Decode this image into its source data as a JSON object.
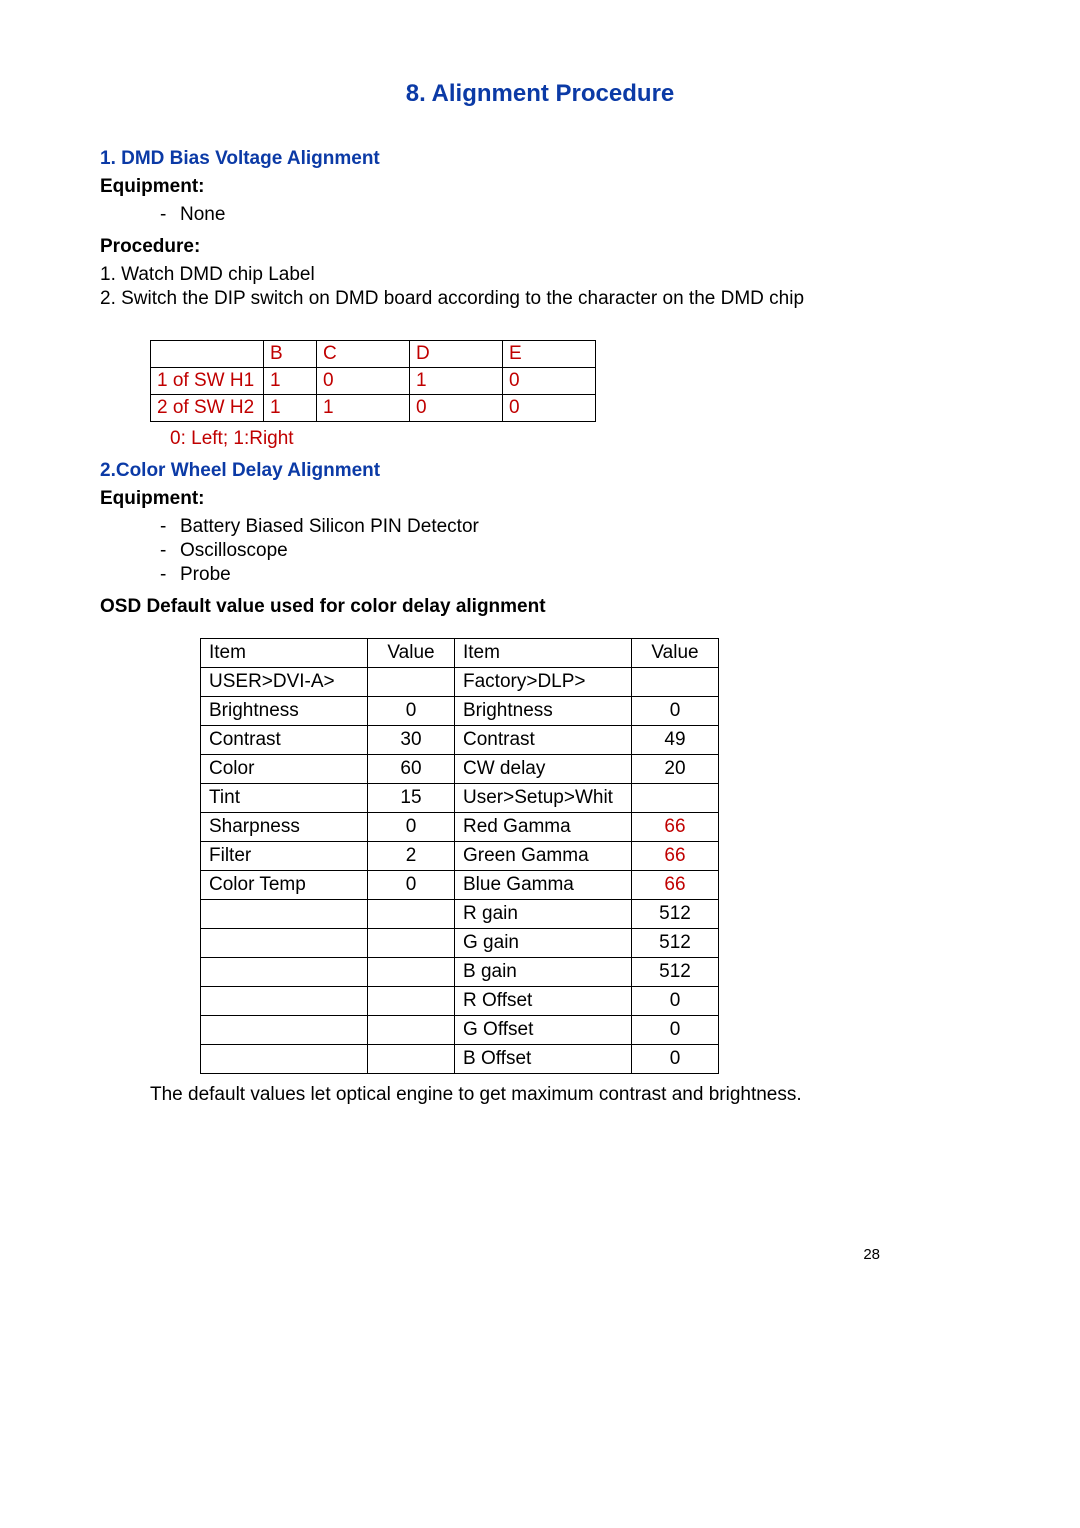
{
  "title": "8. Alignment Procedure",
  "section1": {
    "heading": "1. DMD Bias Voltage Alignment",
    "equipment_label": "Equipment:",
    "equipment_items": [
      "None"
    ],
    "procedure_label": "Procedure:",
    "steps": [
      "1. Watch DMD chip Label",
      "2. Switch the DIP switch on DMD board according to the character on the DMD chip"
    ],
    "dip_table": {
      "headers": [
        "",
        "B",
        "C",
        "D",
        "E"
      ],
      "rows": [
        {
          "label": "1 of SW H1",
          "B": "1",
          "C": "0",
          "D": "1",
          "E": "0"
        },
        {
          "label": "2 of SW H2",
          "B": "1",
          "C": "1",
          "D": "0",
          "E": "0"
        }
      ],
      "note": "0: Left; 1:Right"
    }
  },
  "section2": {
    "heading": "2.Color Wheel Delay Alignment",
    "equipment_label": "Equipment:",
    "equipment_items": [
      "Battery Biased Silicon PIN Detector",
      "Oscilloscope",
      "Probe"
    ],
    "osd_heading": "OSD Default value used for color delay alignment",
    "osd_table": {
      "head": {
        "c1": "Item",
        "c2": "Value",
        "c3": "Item",
        "c4": "Value"
      },
      "rows": [
        {
          "c1": "USER>DVI-A>",
          "c2": "",
          "c3": "Factory>DLP>",
          "c4": ""
        },
        {
          "c1": "Brightness",
          "c2": "0",
          "c3": "Brightness",
          "c4": "0"
        },
        {
          "c1": "Contrast",
          "c2": "30",
          "c3": "Contrast",
          "c4": "49"
        },
        {
          "c1": "Color",
          "c2": "60",
          "c3": "CW delay",
          "c4": "20"
        },
        {
          "c1": "Tint",
          "c2": "15",
          "c3": "User>Setup>Whit",
          "c4": ""
        },
        {
          "c1": "Sharpness",
          "c2": "0",
          "c3": "Red Gamma",
          "c4": "66",
          "red4": true
        },
        {
          "c1": "Filter",
          "c2": "2",
          "c3": "Green Gamma",
          "c4": "66",
          "red4": true
        },
        {
          "c1": "Color Temp",
          "c2": "0",
          "c3": "Blue Gamma",
          "c4": "66",
          "red4": true
        },
        {
          "c1": "",
          "c2": "",
          "c3": "R gain",
          "c4": "512"
        },
        {
          "c1": "",
          "c2": "",
          "c3": "G gain",
          "c4": "512"
        },
        {
          "c1": "",
          "c2": "",
          "c3": "B gain",
          "c4": "512"
        },
        {
          "c1": "",
          "c2": "",
          "c3": "R Offset",
          "c4": "0"
        },
        {
          "c1": "",
          "c2": "",
          "c3": "G Offset",
          "c4": "0"
        },
        {
          "c1": "",
          "c2": "",
          "c3": "B Offset",
          "c4": "0"
        }
      ]
    },
    "footer_note": "The default values let optical engine to get maximum contrast and brightness."
  },
  "page_number": "28"
}
